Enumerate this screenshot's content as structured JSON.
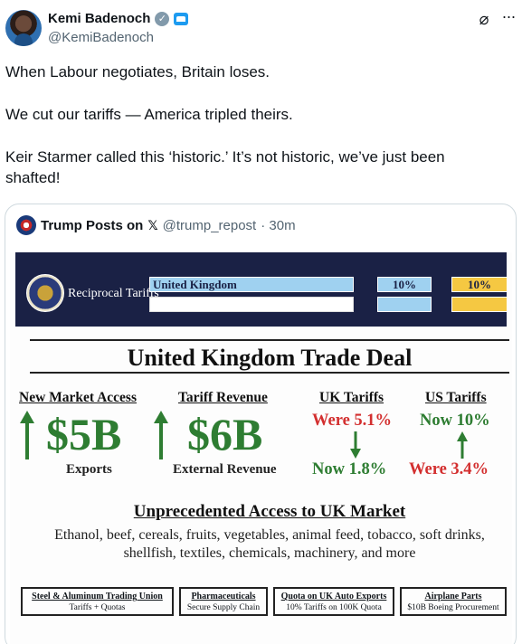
{
  "author": {
    "name": "Kemi Badenoch",
    "handle": "@KemiBadenoch",
    "verified_icon": "verified-badge-icon",
    "affiliate_icon": "government-affiliate-icon"
  },
  "tweet": {
    "line1": "When Labour negotiates, Britain loses.",
    "line2": "We cut our tariffs — America tripled theirs.",
    "line3": "Keir Starmer called this ‘historic.’ It’s not historic, we’ve just been shafted!"
  },
  "quote": {
    "name": "Trump Posts on",
    "x_glyph": "𝕏",
    "handle": "@trump_repost",
    "time": "· 30m"
  },
  "infographic": {
    "banner_label": "Reciprocal Tariffs",
    "country": "United Kingdom",
    "rate1": "10%",
    "rate2": "10%",
    "title": "United Kingdom Trade Deal",
    "col1": {
      "heading": "New Market Access",
      "value": "$5B",
      "label": "Exports"
    },
    "col2": {
      "heading": "Tariff Revenue",
      "value": "$6B",
      "label": "External Revenue"
    },
    "col3": {
      "heading": "UK Tariffs",
      "was": "Were 5.1%",
      "now": "Now 1.8%"
    },
    "col4": {
      "heading": "US Tariffs",
      "now": "Now 10%",
      "was": "Were 3.4%"
    },
    "access_title": "Unprecedented Access to UK Market",
    "access_line1": "Ethanol, beef, cereals, fruits, vegetables, animal feed, tobacco, soft drinks,",
    "access_line2": "shellfish, textiles, chemicals, machinery, and more",
    "footer": [
      {
        "title": "Steel & Aluminum Trading Union",
        "sub": "Tariffs + Quotas"
      },
      {
        "title": "Pharmaceuticals",
        "sub": "Secure Supply Chain"
      },
      {
        "title": "Quota on UK Auto Exports",
        "sub": "10% Tariffs on 100K Quota"
      },
      {
        "title": "Airplane Parts",
        "sub": "$10B Boeing Procurement"
      }
    ],
    "colors": {
      "banner": "#1a2145",
      "green": "#2e7d32",
      "red": "#d32f2f",
      "blue_box": "#9fd1f0",
      "yellow_box": "#f5c842"
    }
  }
}
